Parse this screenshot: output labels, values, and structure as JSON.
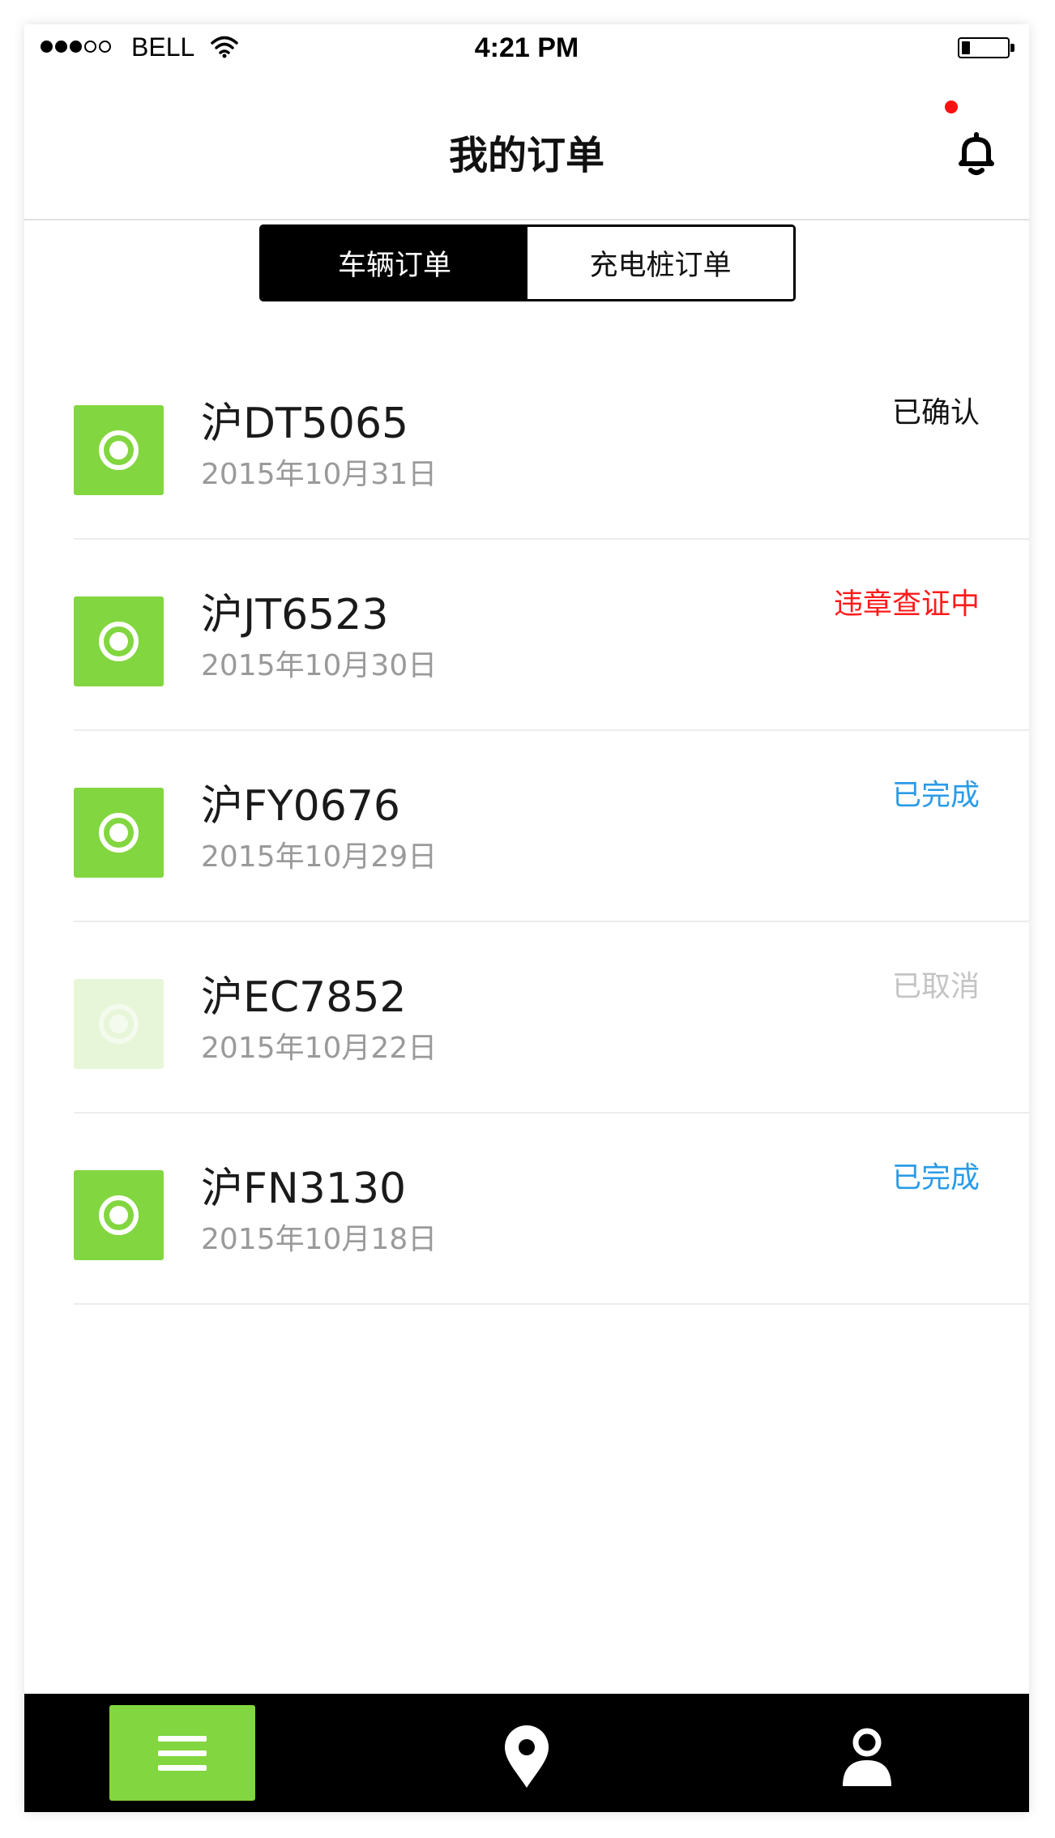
{
  "status_bar": {
    "carrier": "BELL",
    "time": "4:21 PM",
    "signal_bars": 5,
    "signal_filled": 3,
    "battery_level": 0.18
  },
  "header": {
    "title": "我的订单",
    "has_notification": true
  },
  "tabs": [
    {
      "label": "车辆订单",
      "active": true
    },
    {
      "label": "充电桩订单",
      "active": false
    }
  ],
  "orders": [
    {
      "plate": "沪DT5065",
      "date": "2015年10月31日",
      "status": "已确认",
      "status_color": "#111111",
      "faded": false
    },
    {
      "plate": "沪JT6523",
      "date": "2015年10月30日",
      "status": "违章查证中",
      "status_color": "#ff1a1a",
      "faded": false
    },
    {
      "plate": "沪FY0676",
      "date": "2015年10月29日",
      "status": "已完成",
      "status_color": "#2a9be6",
      "faded": false
    },
    {
      "plate": "沪EC7852",
      "date": "2015年10月22日",
      "status": "已取消",
      "status_color": "#c4c4c4",
      "faded": true
    },
    {
      "plate": "沪FN3130",
      "date": "2015年10月18日",
      "status": "已完成",
      "status_color": "#2a9be6",
      "faded": false
    }
  ],
  "tab_bar": [
    {
      "icon": "menu-icon",
      "active": true
    },
    {
      "icon": "location-pin-icon",
      "active": false
    },
    {
      "icon": "user-icon",
      "active": false
    }
  ],
  "colors": {
    "accent": "#82d63f",
    "accent_faded": "#e7f6d8",
    "tab_bar_bg": "#000000",
    "notification": "#ff1010"
  }
}
